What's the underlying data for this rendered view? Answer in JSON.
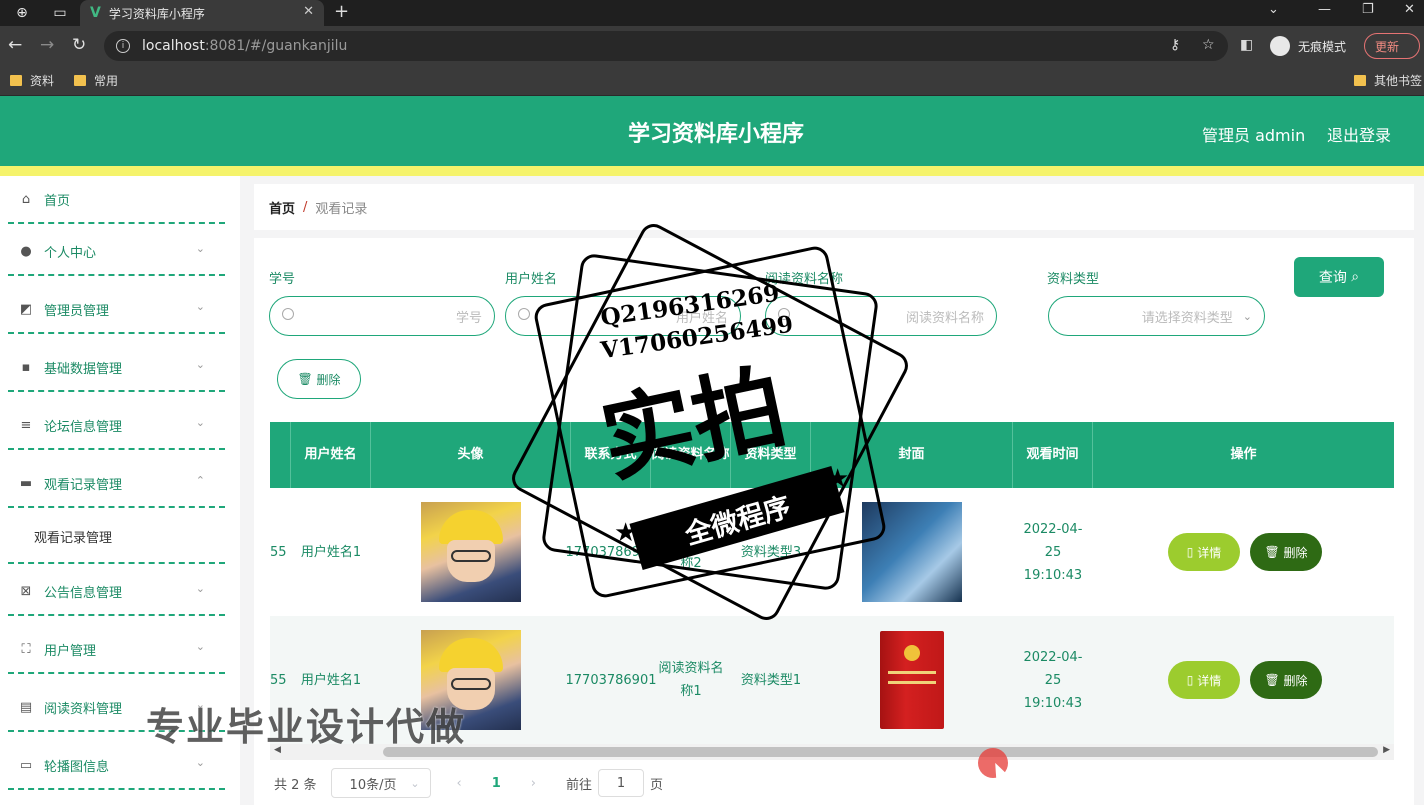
{
  "browser": {
    "tab_title": "学习资料库小程序",
    "url_host": "localhost",
    "url_rest": ":8081/#/guankanjilu",
    "incognito_label": "无痕模式",
    "update_label": "更新",
    "bookmarks": [
      "资料",
      "常用"
    ],
    "other_bookmarks": "其他书签"
  },
  "header": {
    "title": "学习资料库小程序",
    "admin_label": "管理员 admin",
    "logout_label": "退出登录"
  },
  "sidebar": {
    "items": [
      {
        "label": "首页",
        "icon": "home-icon"
      },
      {
        "label": "个人中心",
        "icon": "user-icon"
      },
      {
        "label": "管理员管理",
        "icon": "chart-icon"
      },
      {
        "label": "基础数据管理",
        "icon": "chat-icon"
      },
      {
        "label": "论坛信息管理",
        "icon": "sliders-icon"
      },
      {
        "label": "观看记录管理",
        "icon": "briefcase-icon"
      },
      {
        "label": "公告信息管理",
        "icon": "doc-x-icon"
      },
      {
        "label": "用户管理",
        "icon": "frame-icon"
      },
      {
        "label": "阅读资料管理",
        "icon": "doc-icon"
      },
      {
        "label": "轮播图信息",
        "icon": "monitor-icon"
      }
    ],
    "submenu_label": "观看记录管理"
  },
  "breadcrumb": {
    "home": "首页",
    "separator": "/",
    "current": "观看记录"
  },
  "filters": {
    "student_no": {
      "label": "学号",
      "placeholder": "学号"
    },
    "user_name": {
      "label": "用户姓名",
      "placeholder": "用户姓名"
    },
    "material_name": {
      "label": "阅读资料名称",
      "placeholder": "阅读资料名称"
    },
    "material_type": {
      "label": "资料类型",
      "placeholder": "请选择资料类型"
    },
    "query_label": "查询",
    "delete_label": "删除"
  },
  "table": {
    "headers": [
      "用户姓名",
      "头像",
      "联系方式",
      "阅读资料名称",
      "资料类型",
      "封面",
      "观看时间",
      "操作"
    ],
    "rows": [
      {
        "id": "55",
        "name": "用户姓名1",
        "phone": "17703786901",
        "material": "阅读资料名称2",
        "type": "资料类型3",
        "time": "2022-04-25 19:10:43",
        "cover": "keyboard"
      },
      {
        "id": "55",
        "name": "用户姓名1",
        "phone": "17703786901",
        "material": "阅读资料名称1",
        "type": "资料类型1",
        "time": "2022-04-25 19:10:43",
        "cover": "book"
      }
    ],
    "detail_label": "详情",
    "delete_label": "删除"
  },
  "pagination": {
    "total": "共 2 条",
    "page_size": "10条/页",
    "current_page": "1",
    "goto_label": "前往",
    "goto_value": "1",
    "page_suffix": "页"
  },
  "watermark": {
    "line1": "Q2196316269",
    "line2": "V17060256499",
    "big": "实拍",
    "banner": "全微程序",
    "ad": "专业毕业设计代做"
  },
  "colors": {
    "primary": "#1fa77a",
    "header_strip": "#f5f36b",
    "detail": "#9ccc2e",
    "delete": "#2e6a14"
  }
}
